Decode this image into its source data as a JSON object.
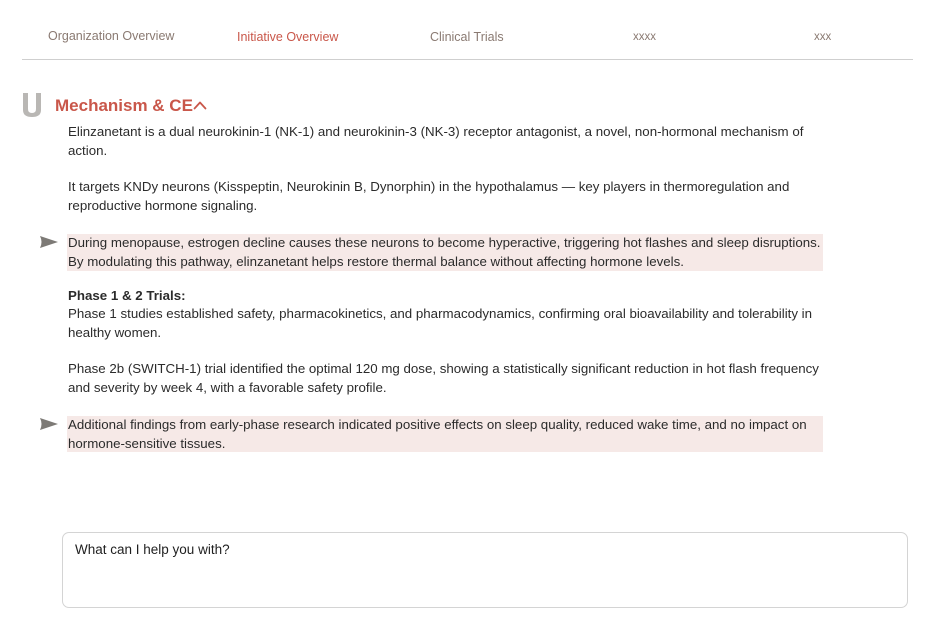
{
  "tabs": [
    {
      "label": "Organization Overview",
      "active": false
    },
    {
      "label": "Initiative Overview",
      "active": true
    },
    {
      "label": "Clinical Trials",
      "active": false
    },
    {
      "label": "xxxx",
      "active": false
    },
    {
      "label": "xxx",
      "active": false
    }
  ],
  "section": {
    "icon": "shield-icon",
    "title": "Mechanism & CE",
    "toggle_icon": "chevron-up-icon"
  },
  "content": {
    "p1": "Elinzanetant is a dual neurokinin-1 (NK-1) and neurokinin-3 (NK-3) receptor antagonist, a novel, non-hormonal mechanism of action.",
    "p2": "It targets KNDy neurons (Kisspeptin, Neurokinin B, Dynorphin) in the hypothalamus — key players in thermoregulation and reproductive hormone signaling.",
    "highlight1": "During menopause, estrogen decline causes these neurons to become hyperactive, triggering hot flashes and sleep disruptions. By modulating this pathway, elinzanetant helps restore thermal balance without affecting hormone levels.",
    "phase_heading": "Phase 1 & 2 Trials:",
    "p3": "Phase 1 studies established safety, pharmacokinetics, and pharmacodynamics, confirming oral bioavailability and tolerability in healthy women.",
    "p4": "Phase 2b (SWITCH-1) trial identified the optimal 120 mg dose, showing a statistically significant reduction in hot flash frequency and severity by week 4, with a favorable safety profile.",
    "highlight2": "Additional findings from early-phase research indicated positive effects on sleep quality, reduced wake time, and no impact on hormone-sensitive tissues."
  },
  "chat": {
    "placeholder": "What can I help you with?"
  },
  "colors": {
    "accent": "#c9574a",
    "tab_inactive": "#8a7a72",
    "highlight_bg": "#f6e9e7",
    "flag": "#7d7a76"
  }
}
